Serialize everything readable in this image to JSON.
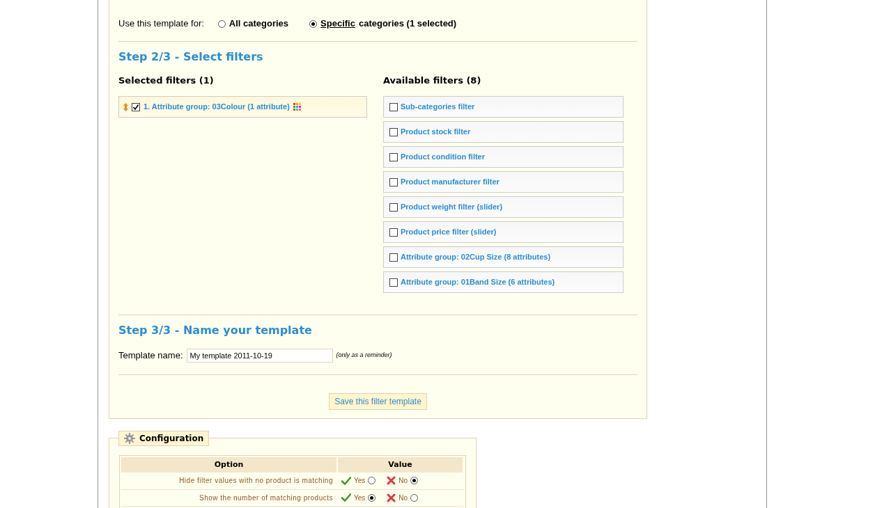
{
  "categories": {
    "label": "Use this template for:",
    "options": [
      {
        "label": "All categories",
        "selected": false
      },
      {
        "label": "Specific",
        "label_rest": "categories (1 selected)",
        "selected": true
      }
    ]
  },
  "step2": {
    "title": "Step 2/3 - Select filters",
    "selected_filters": {
      "title": "Selected filters (1)",
      "items": [
        {
          "label": "1. Attribute group: 03Colour (1 attribute)",
          "checked": true
        }
      ]
    },
    "available_filters": {
      "title": "Available filters (8)",
      "items": [
        {
          "label": "Sub-categories filter",
          "checked": false
        },
        {
          "label": "Product stock filter",
          "checked": false
        },
        {
          "label": "Product condition filter",
          "checked": false
        },
        {
          "label": "Product manufacturer filter",
          "checked": false
        },
        {
          "label": "Product weight filter (slider)",
          "checked": false
        },
        {
          "label": "Product price filter (slider)",
          "checked": false
        },
        {
          "label": "Attribute group: 02Cup Size (8 attributes)",
          "checked": false
        },
        {
          "label": "Attribute group: 01Band Size (6 attributes)",
          "checked": false
        }
      ]
    }
  },
  "step3": {
    "title": "Step 3/3 - Name your template",
    "name_label": "Template name:",
    "name_value": "My template 2011-10-19",
    "hint": "(only as a reminder)"
  },
  "save_button": "Save this filter template",
  "configuration": {
    "title": "Configuration",
    "columns": [
      "Option",
      "Value"
    ],
    "rows": [
      {
        "option": "Hide filter values with no product is matching",
        "choices": [
          {
            "kind": "yes",
            "label": "Yes",
            "selected": false
          },
          {
            "kind": "no",
            "label": "No",
            "selected": true
          }
        ]
      },
      {
        "option": "Show the number of matching products",
        "choices": [
          {
            "kind": "yes",
            "label": "Yes",
            "selected": true
          },
          {
            "kind": "no",
            "label": "No",
            "selected": false
          }
        ]
      }
    ]
  }
}
